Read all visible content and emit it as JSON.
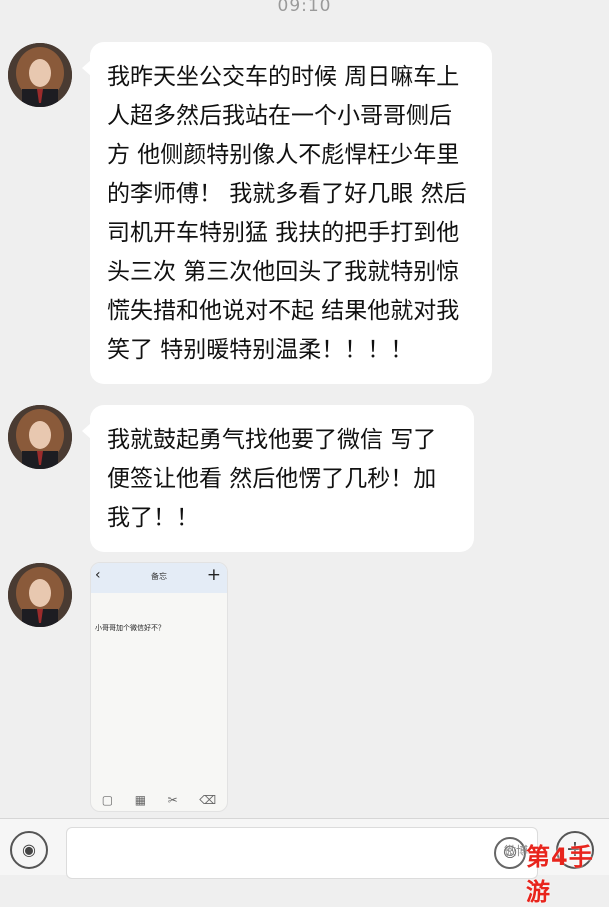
{
  "status_bar": {
    "time": "09:10"
  },
  "messages": [
    {
      "type": "text",
      "text": "我昨天坐公交车的时候 周日嘛车上人超多然后我站在一个小哥哥侧后方 他侧颜特别像人不彪悍枉少年里的李师傅！ 我就多看了好几眼 然后司机开车特别猛 我扶的把手打到他头三次 第三次他回头了我就特别惊慌失措和他说对不起 结果他就对我笑了 特别暖特别温柔！！！！"
    },
    {
      "type": "text",
      "text": "我就鼓起勇气找他要了微信 写了便签让他看 然后他愣了几秒！加我了！！"
    },
    {
      "type": "image",
      "thumbnail": {
        "back": "‹",
        "title": "备忘",
        "plus": "+",
        "note": "小哥哥加个微信好不？",
        "tools": [
          "▢",
          "▦",
          "✂",
          "⌫"
        ]
      }
    }
  ],
  "input_bar": {
    "voice_icon": "voice-icon",
    "voice_glyph": "◉",
    "emoji_glyph": "☺",
    "plus_glyph": "+"
  },
  "watermark": {
    "weibo": "微博",
    "logo": "第4手游"
  }
}
